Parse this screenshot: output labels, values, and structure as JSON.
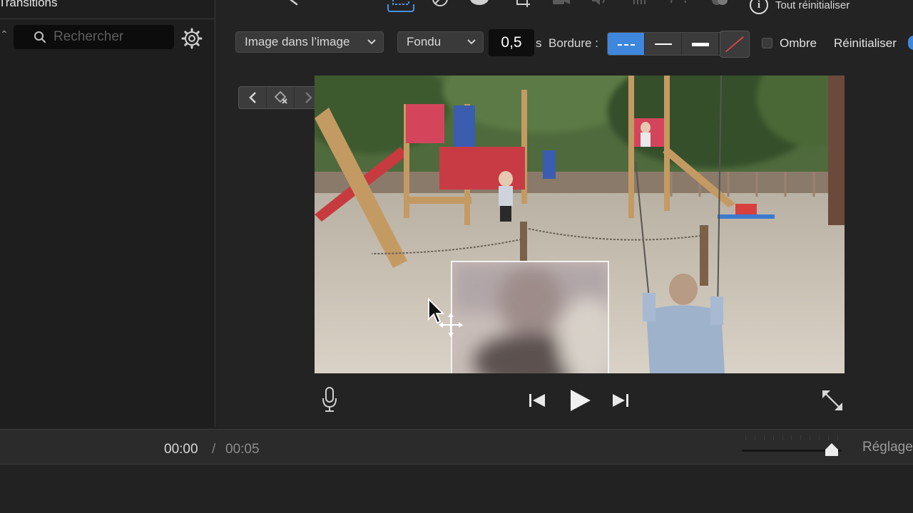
{
  "left_panel": {
    "title": "Transitions",
    "search": {
      "placeholder": "Rechercher",
      "value": ""
    }
  },
  "top_toolbar": {
    "reset_all_label": "Tout réinitialiser",
    "icons": [
      "crop-select-icon",
      "color-balance-icon",
      "color-palette-icon",
      "crop-icon",
      "camera-icon",
      "volume-icon",
      "equalizer-icon",
      "speed-icon",
      "filter-icon",
      "info-icon"
    ]
  },
  "controls": {
    "overlay_mode": "Image dans l’image",
    "transition": "Fondu",
    "duration_value": "0,5",
    "duration_unit": "s",
    "border_label": "Bordure :",
    "border_styles": [
      "dashed",
      "thin",
      "thick"
    ],
    "border_selected": "dashed",
    "border_color": "none",
    "shadow_label": "Ombre",
    "shadow_checked": false,
    "reset_label": "Réinitialiser"
  },
  "playback": {
    "current_time": "00:00",
    "separator": "/",
    "total_time": "00:05"
  },
  "timeline": {
    "settings_label": "Réglages",
    "zoom_level": 0.9
  },
  "colors": {
    "accent": "#3f87dc",
    "panel_bg": "#1e1e1e",
    "field_bg": "#0c0c0c"
  }
}
